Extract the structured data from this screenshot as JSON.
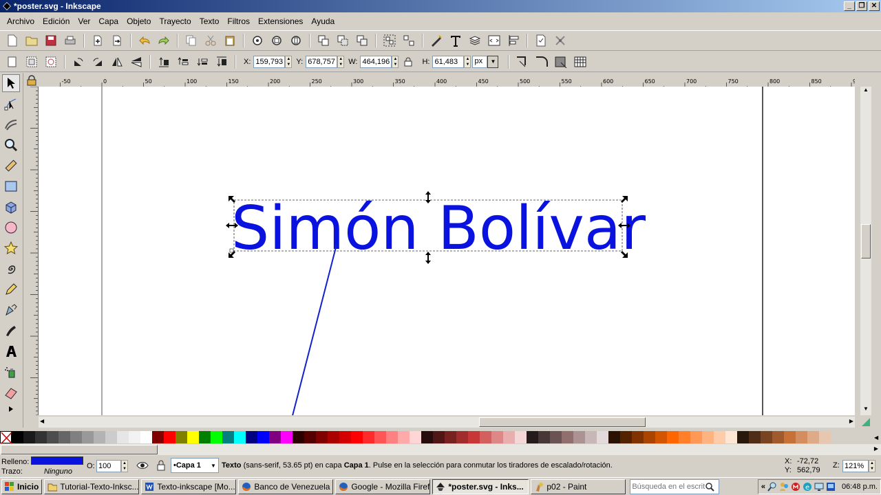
{
  "window": {
    "title": "*poster.svg - Inkscape",
    "buttons": {
      "minimize": "_",
      "maximize": "❐",
      "close": "✕"
    }
  },
  "menu": [
    "Archivo",
    "Edición",
    "Ver",
    "Capa",
    "Objeto",
    "Trayecto",
    "Texto",
    "Filtros",
    "Extensiones",
    "Ayuda"
  ],
  "toolbar_icons": [
    "new-document-icon",
    "open-icon",
    "save-icon",
    "print-icon",
    "import-icon",
    "export-icon",
    "undo-icon",
    "redo-icon",
    "copy-icon",
    "cut-icon",
    "paste-icon",
    "zoom-selection-icon",
    "zoom-drawing-icon",
    "zoom-page-icon",
    "duplicate-icon",
    "clone-icon",
    "unlink-clone-icon",
    "group-icon",
    "ungroup-icon",
    "fill-stroke-icon",
    "text-font-icon",
    "layers-icon",
    "xml-editor-icon",
    "align-icon",
    "document-properties-icon",
    "preferences-icon"
  ],
  "controls": {
    "x_label": "X:",
    "x_value": "159,793",
    "y_label": "Y:",
    "y_value": "678,757",
    "w_label": "W:",
    "w_value": "464,196",
    "h_label": "H:",
    "h_value": "61,483",
    "unit": "px"
  },
  "ruler_ticks": [
    "-50",
    "0",
    "50",
    "100",
    "150",
    "200",
    "250",
    "300",
    "350",
    "400",
    "450",
    "500",
    "550",
    "600",
    "650",
    "700",
    "750",
    "800",
    "850",
    "90"
  ],
  "canvas": {
    "text": "Simón Bolívar",
    "text_color": "#0a12e0"
  },
  "status": {
    "fill_label": "Relleno:",
    "fill_color": "#0a12e0",
    "stroke_label": "Trazo:",
    "stroke_value": "Ninguno",
    "opacity_label": "O:",
    "opacity_value": "100",
    "layer": "•Capa 1",
    "message_bold": "Texto",
    "message_pre": " (sans-serif, 53.65 pt) en capa ",
    "message_layer": "Capa 1",
    "message_post": ". Pulse en la selección para conmutar los tiradores de escalado/rotación.",
    "x_label": "X:",
    "x_value": "-72,72",
    "y_label": "Y:",
    "y_value": "562,79",
    "zoom_label": "Z:",
    "zoom_value": "121%"
  },
  "taskbar": {
    "start": "Inicio",
    "items": [
      {
        "label": "Tutorial-Texto-Inksc...",
        "icon": "folder-icon",
        "active": false
      },
      {
        "label": "Texto-inkscape [Mo...",
        "icon": "word-icon",
        "active": false
      },
      {
        "label": "Banco de Venezuela ...",
        "icon": "firefox-icon",
        "active": false
      },
      {
        "label": "Google - Mozilla Firefox",
        "icon": "firefox-icon",
        "active": false
      },
      {
        "label": "*poster.svg - Inks...",
        "icon": "inkscape-icon",
        "active": true
      },
      {
        "label": "p02 - Paint",
        "icon": "paint-icon",
        "active": false
      }
    ],
    "search_placeholder": "Búsqueda en el escrit",
    "clock": "06:48 p.m."
  },
  "palette_colors": [
    "#000000",
    "#1a1a1a",
    "#333333",
    "#4d4d4d",
    "#666666",
    "#808080",
    "#999999",
    "#b3b3b3",
    "#cccccc",
    "#e6e6e6",
    "#f2f2f2",
    "#ffffff",
    "#800000",
    "#ff0000",
    "#808000",
    "#ffff00",
    "#008000",
    "#00ff00",
    "#008080",
    "#00ffff",
    "#000080",
    "#0000ff",
    "#800080",
    "#ff00ff",
    "#2b0000",
    "#550000",
    "#800000",
    "#aa0000",
    "#d40000",
    "#ff0000",
    "#ff2a2a",
    "#ff5555",
    "#ff8080",
    "#ffaaaa",
    "#ffd5d5",
    "#280b0b",
    "#501616",
    "#782121",
    "#a02c2c",
    "#c83737",
    "#d35f5f",
    "#de8787",
    "#e9afaf",
    "#f4d7d7",
    "#241c1c",
    "#483737",
    "#6c5353",
    "#916f6f",
    "#ac9393",
    "#c8b7b7",
    "#e3dbdb",
    "#2b1100",
    "#552200",
    "#803300",
    "#aa4400",
    "#d45500",
    "#ff6600",
    "#ff7f2a",
    "#ff9955",
    "#ffb380",
    "#ffccaa",
    "#ffe6d5",
    "#28170b",
    "#502d16",
    "#784421",
    "#a05a2c",
    "#c87137",
    "#d38d5f",
    "#deaa87",
    "#e9c6af"
  ]
}
